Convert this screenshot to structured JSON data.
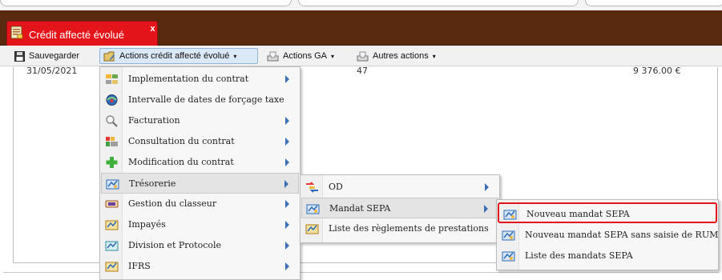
{
  "tab": {
    "title": "Crédit affecté évolué",
    "close": "x"
  },
  "toolbar": {
    "save": "Sauvegarder",
    "actions_credit": "Actions crédit affecté évolué",
    "actions_ga": "Actions GA",
    "other_actions": "Autres actions",
    "caret": "▾"
  },
  "row": {
    "date": "31/05/2021",
    "number": "47",
    "amount": "9 376.00 €"
  },
  "menu_main": [
    {
      "label": "Implementation du contrat",
      "icon": "contract-implementation-icon",
      "submenu": true
    },
    {
      "label": "Intervalle de dates de forçage taxe",
      "icon": "date-range-icon",
      "submenu": false
    },
    {
      "label": "Facturation",
      "icon": "magnifier-icon",
      "submenu": true
    },
    {
      "label": "Consultation du contrat",
      "icon": "contract-consultation-icon",
      "submenu": true
    },
    {
      "label": "Modification du contrat",
      "icon": "plus-icon",
      "submenu": true
    },
    {
      "label": "Trésorerie",
      "icon": "treasury-icon",
      "submenu": true
    },
    {
      "label": "Gestion du classeur",
      "icon": "binder-icon",
      "submenu": true
    },
    {
      "label": "Impayés",
      "icon": "unpaid-icon",
      "submenu": true
    },
    {
      "label": "Division et Protocole",
      "icon": "division-icon",
      "submenu": true
    },
    {
      "label": "IFRS",
      "icon": "ifrs-icon",
      "submenu": true
    }
  ],
  "menu_tresorerie": [
    {
      "label": "OD",
      "icon": "od-icon",
      "submenu": true
    },
    {
      "label": "Mandat SEPA",
      "icon": "mandate-icon",
      "submenu": true
    },
    {
      "label": "Liste des règlements de prestations",
      "icon": "payments-list-icon",
      "submenu": false
    }
  ],
  "menu_sepa": [
    {
      "label": "Nouveau mandat SEPA",
      "icon": "new-mandate-icon"
    },
    {
      "label": "Nouveau mandat SEPA sans saisie de RUM",
      "icon": "new-mandate-no-rum-icon"
    },
    {
      "label": "Liste des mandats SEPA",
      "icon": "mandates-list-icon"
    }
  ],
  "colors": {
    "tabbar": "#5a2a10",
    "tab": "#e3151b",
    "highlight_border": "#e3151b",
    "arrow": "#3b6fb6"
  }
}
